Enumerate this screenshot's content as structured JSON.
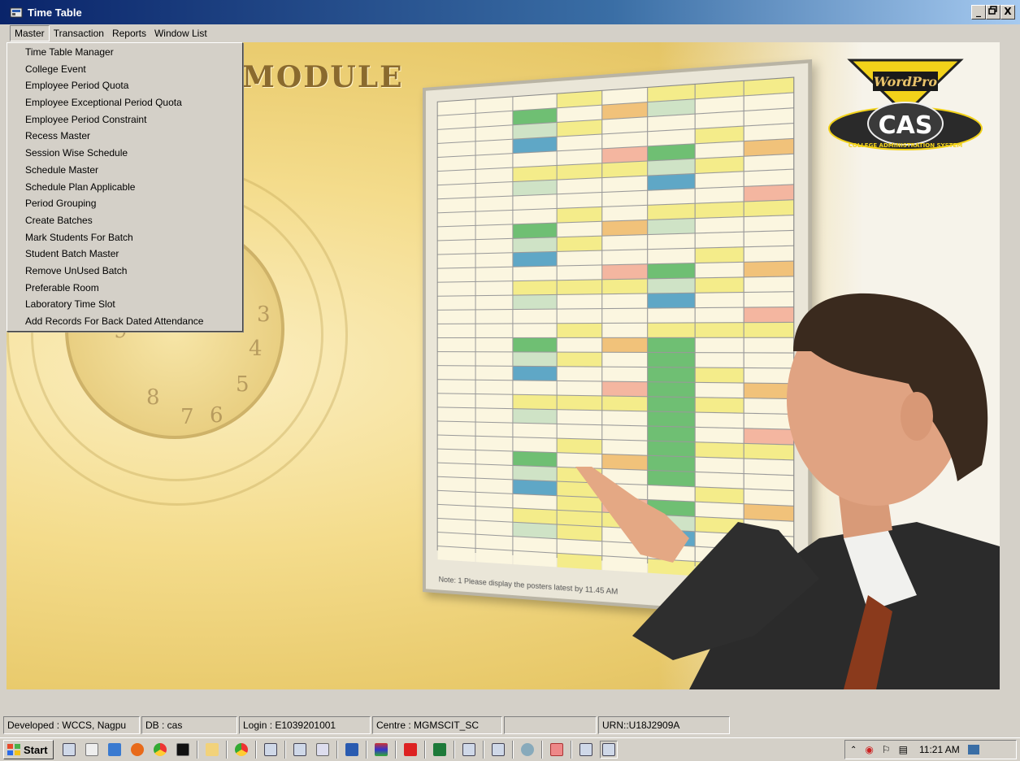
{
  "window": {
    "title": "Time Table",
    "minimize": "_",
    "restore": "§",
    "close": "X"
  },
  "menubar": {
    "items": [
      "Master",
      "Transaction",
      "Reports",
      "Window List"
    ]
  },
  "master_menu": {
    "items": [
      "Time Table Manager",
      "College Event",
      "Employee Period Quota",
      "Employee Exceptional Period Quota",
      "Employee Period Constraint",
      "Recess Master",
      "Session Wise Schedule",
      "Schedule Master",
      "Schedule Plan Applicable",
      "Period Grouping",
      "Create Batches",
      "Mark Students For Batch",
      "Student Batch Master",
      "Remove UnUsed Batch",
      "Preferable Room",
      "Laboratory Time Slot",
      "Add Records For Back Dated Attendance"
    ]
  },
  "banner": {
    "module_text": "MODULE",
    "logo_top": "WordPro",
    "logo_main": "CAS",
    "logo_ring": "COLLEGE ADMINISTRATION SYSTEM",
    "board_note": "Note:  1  Please display the posters latest by 11.45 AM"
  },
  "statusbar": {
    "developed": "Developed : WCCS, Nagpu",
    "db": "DB : cas",
    "login": "Login : E1039201001",
    "centre": "Centre : MGMSCIT_SC",
    "blank": "",
    "urn": "URN::U18J2909A"
  },
  "taskbar": {
    "start": "Start",
    "clock": "11:21 AM"
  }
}
